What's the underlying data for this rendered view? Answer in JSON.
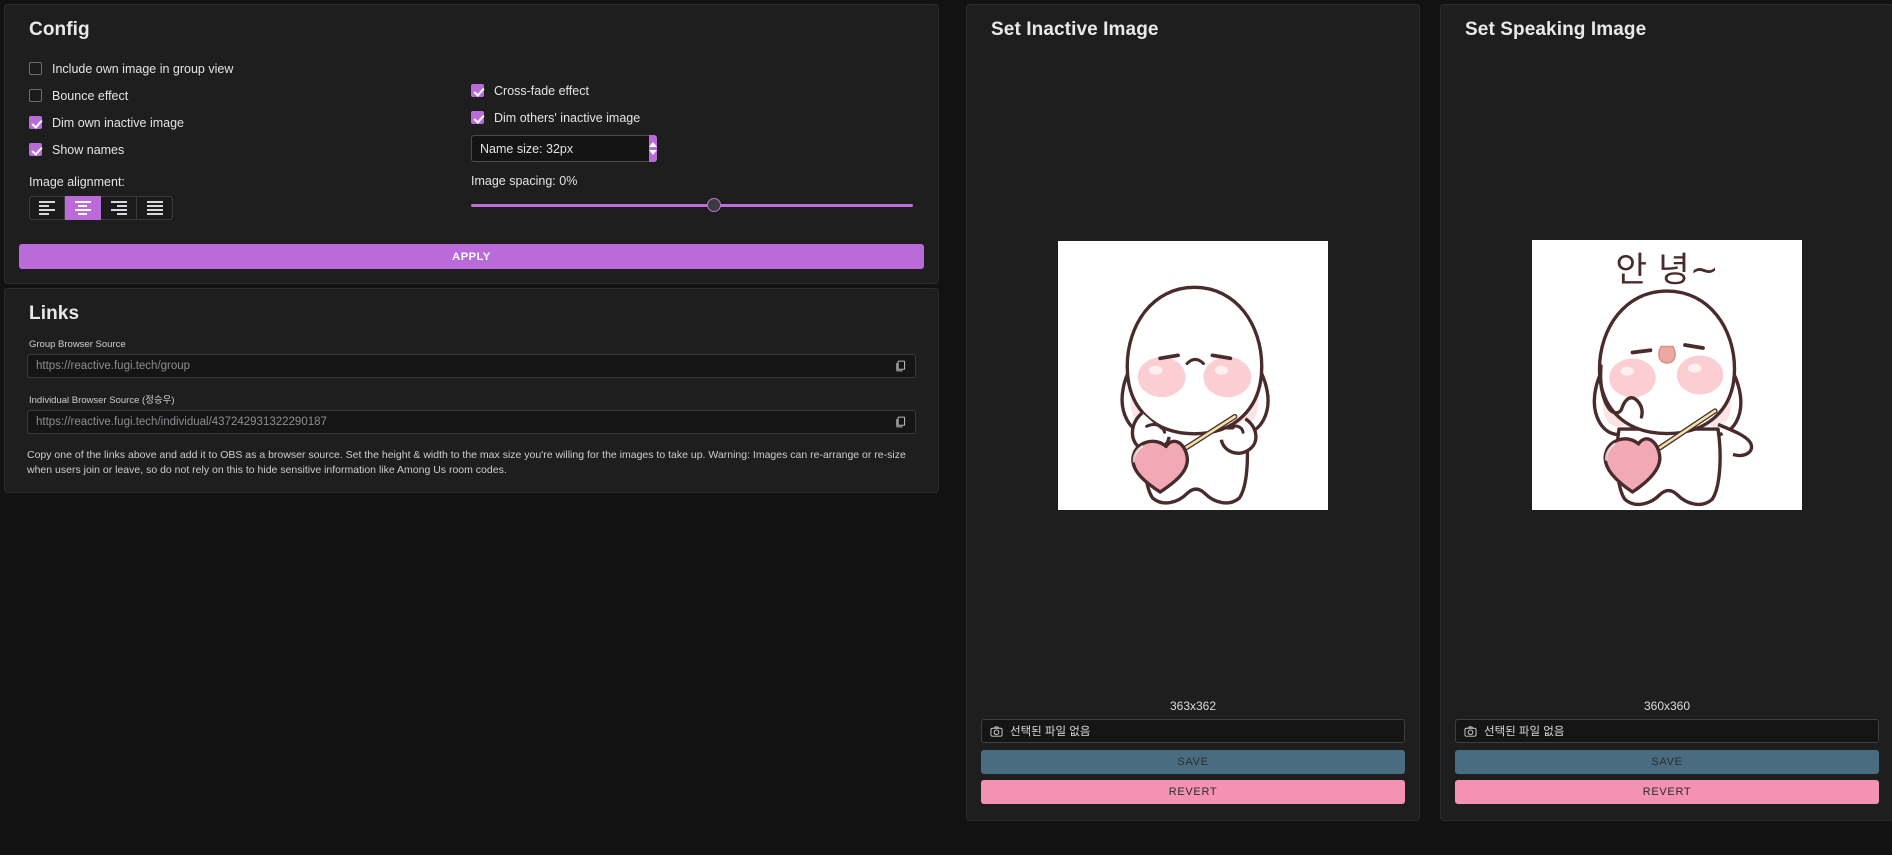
{
  "theme": {
    "bg": "#121212",
    "panel": "#1e1e1e",
    "accent": "#bb6bd9",
    "save": "#4a6c80",
    "revert": "#f592b4"
  },
  "config": {
    "title": "Config",
    "checkboxes_left": [
      {
        "label": "Include own image in group view",
        "checked": false
      },
      {
        "label": "Bounce effect",
        "checked": false
      },
      {
        "label": "Dim own inactive image",
        "checked": true
      },
      {
        "label": "Show names",
        "checked": true
      }
    ],
    "checkboxes_right": [
      {
        "label": "Cross-fade effect",
        "checked": true
      },
      {
        "label": "Dim others' inactive image",
        "checked": true
      }
    ],
    "name_size": {
      "value": "Name size: 32px",
      "number": 32,
      "unit": "px"
    },
    "image_spacing": {
      "label": "Image spacing: 0%",
      "value": 0,
      "thumb_percent": 55
    },
    "alignment": {
      "label": "Image alignment:",
      "options": [
        "align-left",
        "align-center",
        "align-right",
        "align-justify"
      ],
      "selected": "align-center"
    },
    "apply_label": "APPLY"
  },
  "links": {
    "title": "Links",
    "fields": [
      {
        "label": "Group Browser Source",
        "value": "https://reactive.fugi.tech/group"
      },
      {
        "label": "Individual Browser Source (정승우)",
        "value": "https://reactive.fugi.tech/individual/437242931322290187"
      }
    ],
    "note": "Copy one of the links above and add it to OBS as a browser source. Set the height & width to the max size you're willing for the images to take up. Warning: Images can re-arrange or re-size when users join or leave, so do not rely on this to hide sensitive information like Among Us room codes."
  },
  "inactive_panel": {
    "title": "Set Inactive Image",
    "dimensions": "363x362",
    "file_input_text": "선택된 파일 없음",
    "save_label": "SAVE",
    "revert_label": "REVERT",
    "image_alt": "white bunny character with blushing cheeks and heart bag"
  },
  "speaking_panel": {
    "title": "Set Speaking Image",
    "dimensions": "360x360",
    "file_input_text": "선택된 파일 없음",
    "save_label": "SAVE",
    "revert_label": "REVERT",
    "speech_text": "안 녕~",
    "image_alt": "white bunny character waving with speech text"
  }
}
